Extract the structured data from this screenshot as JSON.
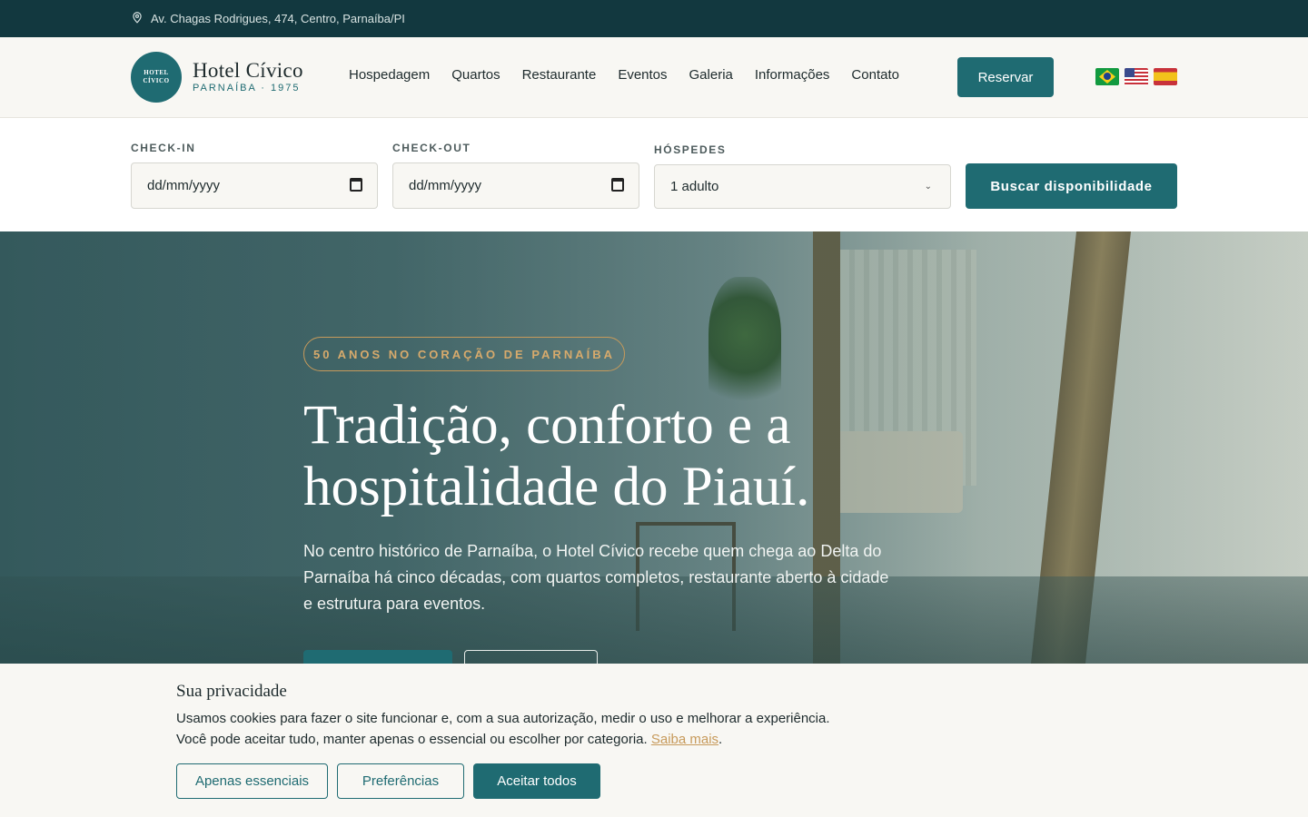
{
  "topbar": {
    "address": "Av. Chagas Rodrigues, 474, Centro, Parnaíba/PI",
    "icon": "location-pin-icon"
  },
  "header": {
    "logo_badge_line1": "HOTEL",
    "logo_badge_line2": "CÍVICO",
    "logo_title": "Hotel Cívico",
    "logo_subtitle": "PARNAÍBA · 1975",
    "nav": [
      "Hospedagem",
      "Quartos",
      "Restaurante",
      "Eventos",
      "Galeria",
      "Informações",
      "Contato"
    ],
    "reserve_label": "Reservar",
    "languages": [
      "pt-BR",
      "en-US",
      "es-ES"
    ]
  },
  "booking": {
    "checkin_label": "CHECK-IN",
    "checkin_value": "dd/mm/yyyy",
    "checkout_label": "CHECK-OUT",
    "checkout_value": "dd/mm/yyyy",
    "guests_label": "HÓSPEDES",
    "guests_value": "1 adulto",
    "search_label": "Buscar disponibilidade"
  },
  "hero": {
    "badge": "50 ANOS NO CORAÇÃO DE PARNAÍBA",
    "title": "Tradição, conforto e a hospitalidade do Piauí.",
    "text": "No centro histórico de Parnaíba, o Hotel Cívico recebe quem chega ao Delta do Parnaíba há cinco décadas, com quartos completos, restaurante aberto à cidade e estrutura para eventos."
  },
  "cookie": {
    "title": "Sua privacidade",
    "text": "Usamos cookies para fazer o site funcionar e, com a sua autorização, medir o uso e melhorar a experiência. Você pode aceitar tudo, manter apenas o essencial ou escolher por categoria.",
    "link": "Saiba mais",
    "link_suffix": ".",
    "btn_essential": "Apenas essenciais",
    "btn_prefs": "Preferências",
    "btn_accept": "Aceitar todos"
  },
  "colors": {
    "primary": "#1f6b72",
    "topbar": "#12383f",
    "accent": "#c79a5b"
  }
}
